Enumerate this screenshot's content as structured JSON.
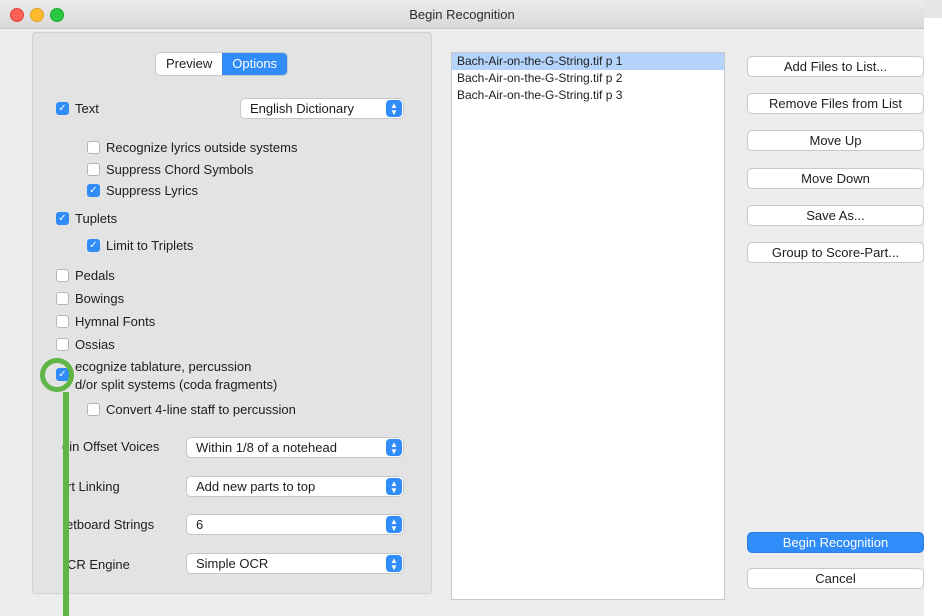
{
  "window": {
    "title": "Begin Recognition"
  },
  "tabs": {
    "preview": "Preview",
    "options": "Options"
  },
  "options": {
    "text": {
      "label": "Text",
      "checked": true
    },
    "dictionary": "English Dictionary",
    "lyrics_outside": {
      "label": "Recognize lyrics outside systems",
      "checked": false
    },
    "suppress_chord": {
      "label": "Suppress Chord Symbols",
      "checked": false
    },
    "suppress_lyrics": {
      "label": "Suppress Lyrics",
      "checked": true
    },
    "tuplets": {
      "label": "Tuplets",
      "checked": true
    },
    "limit_triplets": {
      "label": "Limit to Triplets",
      "checked": true
    },
    "pedals": {
      "label": "Pedals",
      "checked": false
    },
    "bowings": {
      "label": "Bowings",
      "checked": false
    },
    "hymnal": {
      "label": "Hymnal Fonts",
      "checked": false
    },
    "ossias": {
      "label": "Ossias",
      "checked": false
    },
    "tablature": {
      "line1": "ecognize tablature, percussion",
      "line2": "d/or split systems (coda fragments)",
      "checked": true
    },
    "convert4": {
      "label": "Convert 4-line staff to percussion",
      "checked": false
    },
    "join_label": "oin Offset Voices",
    "join_value": "Within 1/8 of a notehead",
    "part_label": "rt Linking",
    "part_value": "Add new parts to top",
    "fret_label": "etboard Strings",
    "fret_value": "6",
    "ocr_label": "CR Engine",
    "ocr_value": "Simple OCR"
  },
  "files": [
    "Bach-Air-on-the-G-String.tif p  1",
    "Bach-Air-on-the-G-String.tif p  2",
    "Bach-Air-on-the-G-String.tif p  3"
  ],
  "buttons": {
    "add": "Add Files to List...",
    "remove": "Remove Files from List",
    "up": "Move Up",
    "down": "Move Down",
    "save": "Save As...",
    "group": "Group to Score-Part...",
    "begin": "Begin Recognition",
    "cancel": "Cancel"
  },
  "colors": {
    "accent": "#2f8cf8",
    "highlight": "#5fb545"
  }
}
